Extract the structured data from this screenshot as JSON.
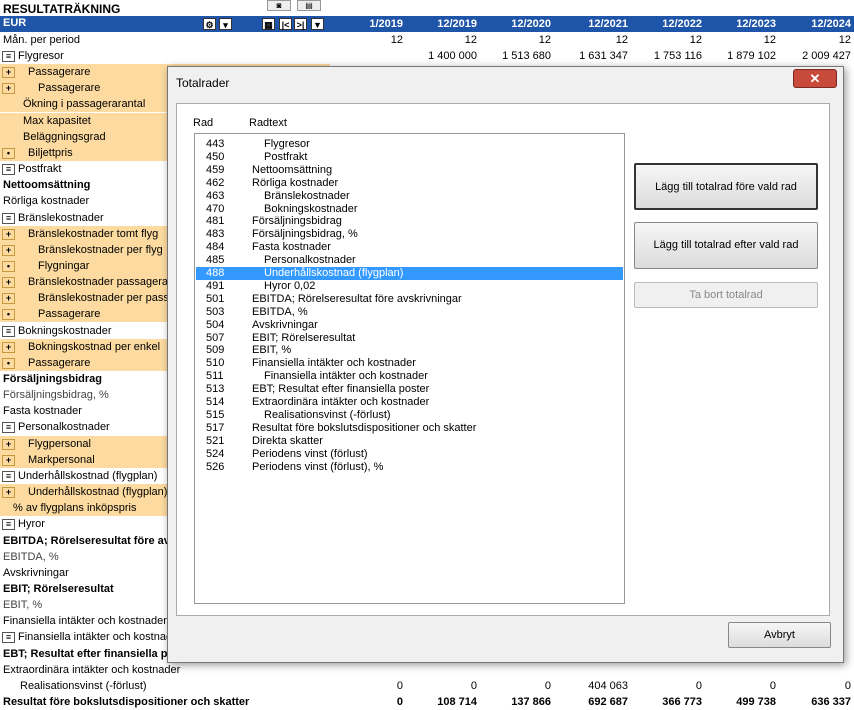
{
  "sheet": {
    "title": "RESULTATRÄKNING",
    "currency": "EUR",
    "col_headers": [
      "1/2019",
      "12/2019",
      "12/2020",
      "12/2021",
      "12/2022",
      "12/2023",
      "12/2024"
    ],
    "man_label": "Mån. per period",
    "man_values": [
      "12",
      "12",
      "12",
      "12",
      "12",
      "12",
      "12"
    ],
    "rows": [
      {
        "label": "Flygresor",
        "btn": "≡",
        "values": [
          "",
          "1 400 000",
          "1 513 680",
          "1 631 347",
          "1 753 116",
          "1 879 102",
          "2 009 427"
        ]
      },
      {
        "label": "Passagerare",
        "btn": "+"
      },
      {
        "label": "Passagerare",
        "btn": "+"
      },
      {
        "label": "Ökning i passagerarantal"
      },
      {
        "label": "Max kapasitet"
      },
      {
        "label": "Beläggningsgrad"
      },
      {
        "label": "Biljettpris",
        "btn": "•"
      },
      {
        "label": "Postfrakt",
        "btn": "≡"
      },
      {
        "label": "Nettoomsättning"
      },
      {
        "label": "Rörliga kostnader"
      },
      {
        "label": "Bränslekostnader",
        "btn": "≡"
      },
      {
        "label": "Bränslekostnader tomt flyg",
        "btn": "+"
      },
      {
        "label": "Bränslekostnader per flyg",
        "btn": "+"
      },
      {
        "label": "Flygningar",
        "btn": "•"
      },
      {
        "label": "Bränslekostnader passagerare",
        "btn": "+"
      },
      {
        "label": "Bränslekostnader per passagerare",
        "btn": "+"
      },
      {
        "label": "Passagerare",
        "btn": "•"
      },
      {
        "label": "Bokningskostnader",
        "btn": "≡"
      },
      {
        "label": "Bokningskostnad per enkel",
        "btn": "+"
      },
      {
        "label": "Passagerare",
        "btn": "•"
      },
      {
        "label": "Försäljningsbidrag"
      },
      {
        "label": "Försäljningsbidrag, %"
      },
      {
        "label": "Fasta kostnader"
      },
      {
        "label": "Personalkostnader",
        "btn": "≡"
      },
      {
        "label": "Flygpersonal",
        "btn": "+"
      },
      {
        "label": "Markpersonal",
        "btn": "+"
      },
      {
        "label": "Underhållskostnad (flygplan)",
        "btn": "≡"
      },
      {
        "label": "Underhållskostnad (flygplan)",
        "btn": "+"
      },
      {
        "label": "% av flygplans inköpspris"
      },
      {
        "label": "Hyror",
        "btn": "≡"
      },
      {
        "label": "EBITDA; Rörelseresultat före avskrivningar"
      },
      {
        "label": "EBITDA, %"
      },
      {
        "label": "Avskrivningar"
      },
      {
        "label": "EBIT; Rörelseresultat"
      },
      {
        "label": "EBIT, %"
      },
      {
        "label": "Finansiella intäkter och kostnader"
      },
      {
        "label": "Finansiella intäkter och kostnader",
        "btn": "≡"
      },
      {
        "label": "EBT; Resultat efter finansiella poster"
      },
      {
        "label": "Extraordinära intäkter och kostnader"
      },
      {
        "label": "Realisationsvinst (-förlust)",
        "values": [
          "0",
          "0",
          "0",
          "404 063",
          "0",
          "0",
          "0"
        ]
      },
      {
        "label": "Resultat före bokslutsdispositioner och skatter",
        "values": [
          "0",
          "108 714",
          "137 866",
          "692 687",
          "366 773",
          "499 738",
          "636 337"
        ]
      }
    ]
  },
  "dialog": {
    "title": "Totalrader",
    "close": "✕",
    "col_rad": "Rad",
    "col_text": "Radtext",
    "items": [
      {
        "rad": "443",
        "text": "Flygresor",
        "indent": 1
      },
      {
        "rad": "450",
        "text": "Postfrakt",
        "indent": 1
      },
      {
        "rad": "459",
        "text": "Nettoomsättning",
        "indent": 0
      },
      {
        "rad": "462",
        "text": "Rörliga kostnader",
        "indent": 0
      },
      {
        "rad": "463",
        "text": "Bränslekostnader",
        "indent": 1
      },
      {
        "rad": "470",
        "text": "Bokningskostnader",
        "indent": 1
      },
      {
        "rad": "481",
        "text": "Försäljningsbidrag",
        "indent": 0
      },
      {
        "rad": "483",
        "text": "Försäljningsbidrag, %",
        "indent": 0
      },
      {
        "rad": "484",
        "text": "Fasta kostnader",
        "indent": 0
      },
      {
        "rad": "485",
        "text": "Personalkostnader",
        "indent": 1
      },
      {
        "rad": "488",
        "text": "Underhållskostnad (flygplan)",
        "indent": 1,
        "selected": true
      },
      {
        "rad": "491",
        "text": "Hyror 0,02",
        "indent": 1
      },
      {
        "rad": "501",
        "text": "EBITDA; Rörelseresultat före avskrivningar",
        "indent": 0
      },
      {
        "rad": "503",
        "text": "EBITDA, %",
        "indent": 0
      },
      {
        "rad": "504",
        "text": "Avskrivningar",
        "indent": 0
      },
      {
        "rad": "507",
        "text": "EBIT; Rörelseresultat",
        "indent": 0
      },
      {
        "rad": "509",
        "text": "EBIT, %",
        "indent": 0
      },
      {
        "rad": "510",
        "text": "Finansiella intäkter och kostnader",
        "indent": 0
      },
      {
        "rad": "511",
        "text": "Finansiella intäkter och kostnader",
        "indent": 1
      },
      {
        "rad": "513",
        "text": "EBT; Resultat efter finansiella poster",
        "indent": 0
      },
      {
        "rad": "514",
        "text": "Extraordinära intäkter och kostnader",
        "indent": 0
      },
      {
        "rad": "515",
        "text": "Realisationsvinst (-förlust)",
        "indent": 1
      },
      {
        "rad": "517",
        "text": "Resultat före bokslutsdispositioner och skatter",
        "indent": 0
      },
      {
        "rad": "521",
        "text": "Direkta skatter",
        "indent": 0
      },
      {
        "rad": "524",
        "text": "Periodens vinst (förlust)",
        "indent": 0
      },
      {
        "rad": "526",
        "text": "Periodens vinst (förlust), %",
        "indent": 0
      }
    ],
    "btn_before": "Lägg till totalrad före vald rad",
    "btn_after": "Lägg till totalrad efter vald rad",
    "btn_remove": "Ta bort totalrad",
    "btn_cancel": "Avbryt"
  }
}
